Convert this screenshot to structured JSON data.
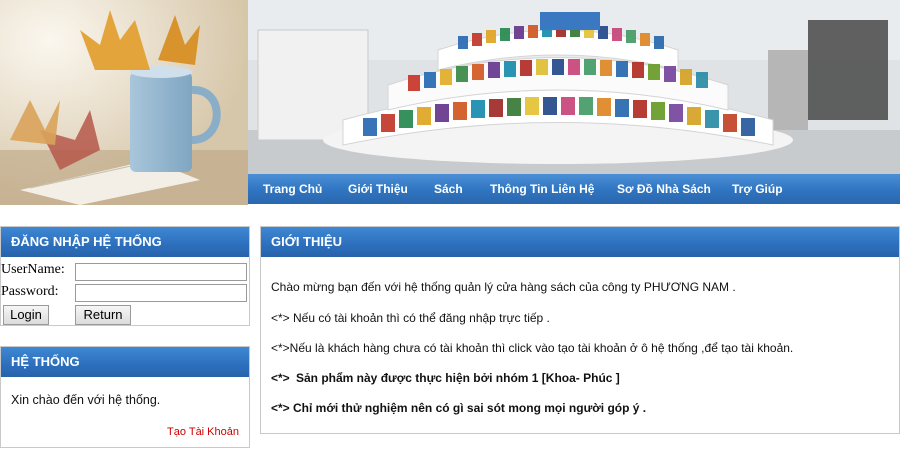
{
  "nav": {
    "items": [
      "Trang Chủ",
      "Giới Thiệu",
      "Sách",
      "Thông Tin Liên Hệ",
      "Sơ Đồ Nhà Sách",
      "Trợ Giúp"
    ]
  },
  "login": {
    "title": "ĐĂNG NHẬP HỆ THỐNG",
    "username_label": "UserName:",
    "password_label": "Password:",
    "username_value": "",
    "password_value": "",
    "login_button": "Login",
    "return_button": "Return"
  },
  "system": {
    "title": "HỆ THỐNG",
    "welcome": "Xin chào đến với hệ thống.",
    "create_account": "Tạo Tài Khoản"
  },
  "intro": {
    "title": "GIỚI THIỆU",
    "line1": "Chào mừng bạn đến với hệ thống quản lý cửa hàng sách của công ty PHƯƠNG NAM .",
    "line2": "<*> Nếu có tài khoản thì có thể đăng nhập trực tiếp .",
    "line3": "<*>Nếu là khách hàng chưa có tài khoản thì click vào tạo tài khoản ở ô hệ thống ,để tạo tài khoản.",
    "line4_prefix": "<*>",
    "line4": "Sản phẩm này được thực hiện bởi nhóm 1 [Khoa- Phúc   ]",
    "line5": "<*> Chỉ mới thử nghiệm nên có gì sai sót mong mọi người góp ý ."
  },
  "colors": {
    "header_blue": "#2f74c0",
    "nav_text": "#ffffff",
    "link_red": "#cc0000"
  }
}
